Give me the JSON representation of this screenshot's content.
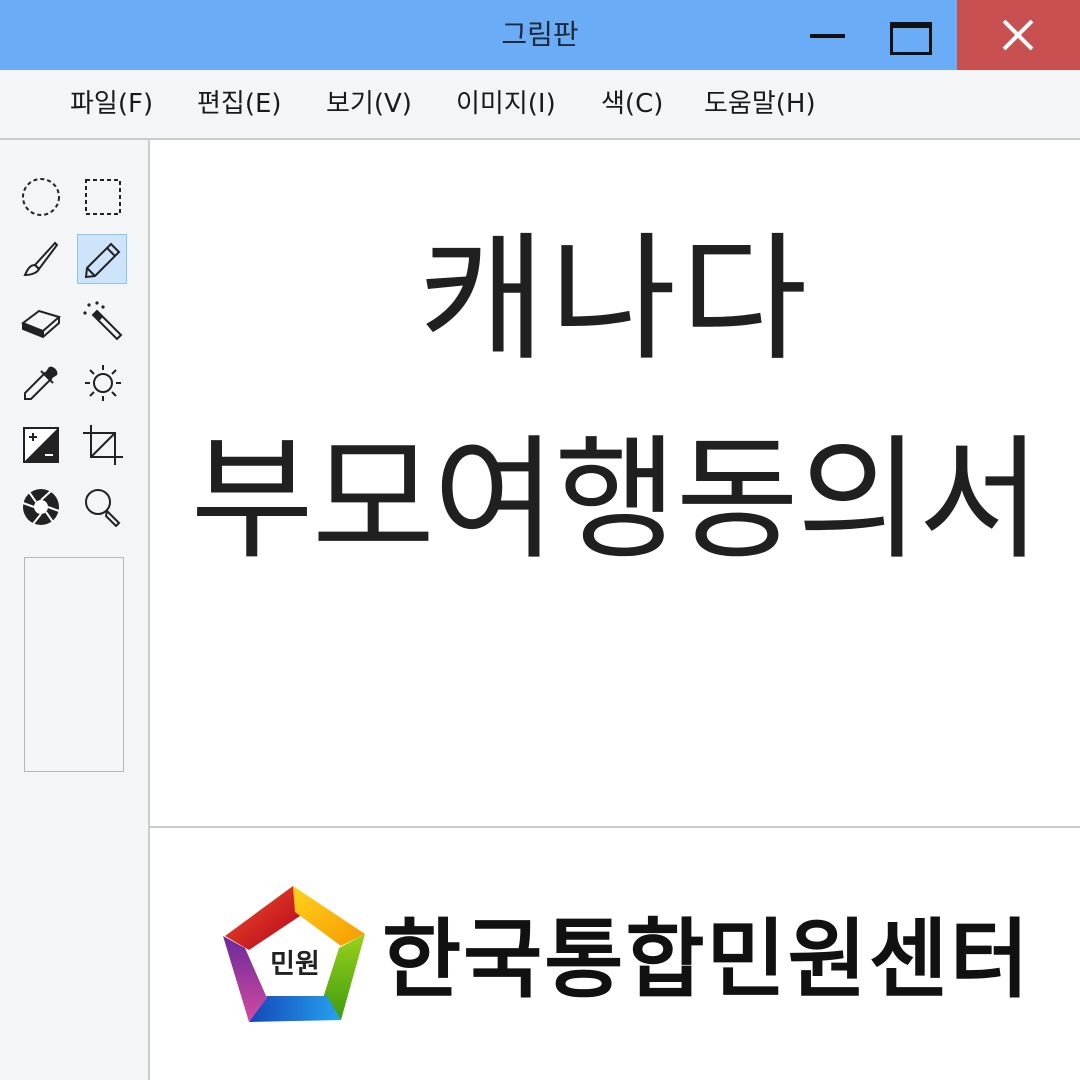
{
  "window": {
    "title": "그림판",
    "minimize_icon": "minimize-icon",
    "maximize_icon": "maximize-icon",
    "close_icon": "close-icon",
    "close_color": "#c85050",
    "titlebar_color": "#6aacf6"
  },
  "menu": {
    "items": [
      {
        "label": "파일(F)"
      },
      {
        "label": "편집(E)"
      },
      {
        "label": "보기(V)"
      },
      {
        "label": "이미지(I)"
      },
      {
        "label": "색(C)"
      },
      {
        "label": "도움말(H)"
      }
    ]
  },
  "tools": [
    {
      "name": "free-select",
      "icon": "ellipse-select-icon"
    },
    {
      "name": "rect-select",
      "icon": "rect-select-icon"
    },
    {
      "name": "brush",
      "icon": "brush-icon"
    },
    {
      "name": "pencil",
      "icon": "pencil-icon",
      "active": true
    },
    {
      "name": "eraser",
      "icon": "eraser-icon"
    },
    {
      "name": "magic-wand",
      "icon": "magic-wand-icon"
    },
    {
      "name": "color-picker",
      "icon": "eyedropper-icon"
    },
    {
      "name": "brightness",
      "icon": "brightness-icon"
    },
    {
      "name": "contrast",
      "icon": "contrast-icon"
    },
    {
      "name": "crop",
      "icon": "crop-icon"
    },
    {
      "name": "aperture",
      "icon": "aperture-icon"
    },
    {
      "name": "zoom",
      "icon": "magnifier-icon"
    }
  ],
  "canvas": {
    "heading_line1": "캐나다",
    "heading_line2": "부모여행동의서",
    "logo_badge": "민원",
    "logo_name": "한국통합민원센터"
  }
}
